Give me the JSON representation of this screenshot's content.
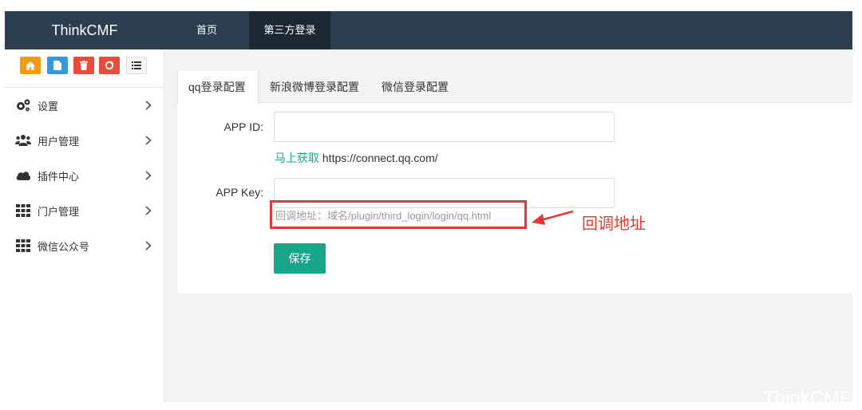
{
  "app": {
    "brand": "ThinkCMF"
  },
  "topnav": {
    "home": "首页",
    "third_login": "第三方登录"
  },
  "sidebar": {
    "shortcuts": [
      "home-icon",
      "document-icon",
      "trash-icon",
      "recycle-icon",
      "list-icon"
    ],
    "items": [
      {
        "label": "设置",
        "icon": "gears-icon"
      },
      {
        "label": "用户管理",
        "icon": "users-icon"
      },
      {
        "label": "插件中心",
        "icon": "cloud-icon"
      },
      {
        "label": "门户管理",
        "icon": "grid-icon"
      },
      {
        "label": "微信公众号",
        "icon": "grid-icon"
      }
    ]
  },
  "tabs": [
    "qq登录配置",
    "新浪微博登录配置",
    "微信登录配置"
  ],
  "form": {
    "app_id_label": "APP ID:",
    "app_id_value": "",
    "get_link": "马上获取",
    "get_url": "https://connect.qq.com/",
    "app_key_label": "APP Key:",
    "app_key_value": "",
    "callback_hint": "回调地址：域名/plugin/third_login/login/qq.html",
    "save": "保存"
  },
  "annotation": {
    "text": "回调地址"
  },
  "watermark": "ThinkCMF",
  "colors": {
    "topbar": "#2c3e50",
    "active_nav": "#1c2833",
    "accent": "#18a689",
    "highlight": "#e53935"
  }
}
